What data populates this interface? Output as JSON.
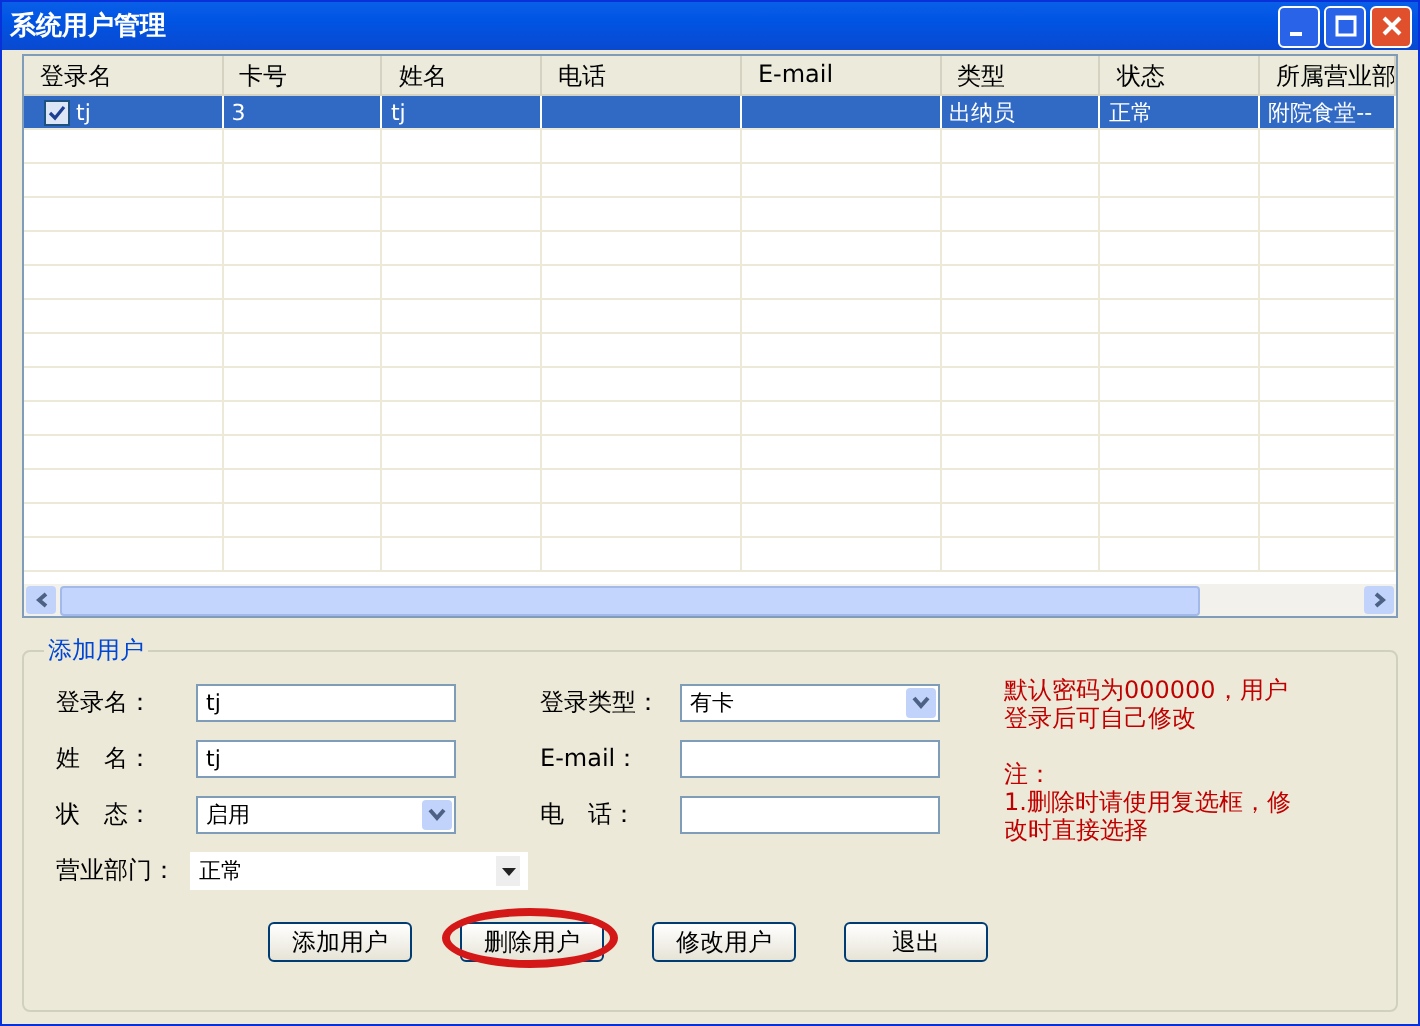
{
  "window": {
    "title": "系统用户管理"
  },
  "table": {
    "columns": [
      "登录名",
      "卡号",
      "姓名",
      "电话",
      "E-mail",
      "类型",
      "状态",
      "所属营业部"
    ],
    "rows": [
      {
        "checked": true,
        "selected": true,
        "cells": [
          "tj",
          "3",
          "tj",
          "",
          "",
          "出纳员",
          "正常",
          "附院食堂--"
        ]
      }
    ]
  },
  "form": {
    "title": "添加用户",
    "fields": [
      {
        "kind": "text",
        "label": "登录名：",
        "value": "tj"
      },
      {
        "kind": "select",
        "label": "登录类型：",
        "value": "有卡"
      },
      {
        "kind": "text",
        "label": "姓　名：",
        "value": "tj"
      },
      {
        "kind": "text",
        "label": "E-mail："
      },
      {
        "kind": "select",
        "label": "状　态：",
        "value": "启用"
      },
      {
        "kind": "text",
        "label": "电　话："
      },
      {
        "kind": "combo",
        "label": "营业部门：",
        "value": "正常"
      }
    ],
    "notes": [
      "默认密码为000000，用户登录后可自己修改",
      "注：",
      "1.删除时请使用复选框，修改时直接选择"
    ],
    "buttons": [
      {
        "label": "添加用户",
        "highlighted": false
      },
      {
        "label": "删除用户",
        "highlighted": true
      },
      {
        "label": "修改用户",
        "highlighted": false
      },
      {
        "label": "退出",
        "highlighted": false
      }
    ]
  }
}
